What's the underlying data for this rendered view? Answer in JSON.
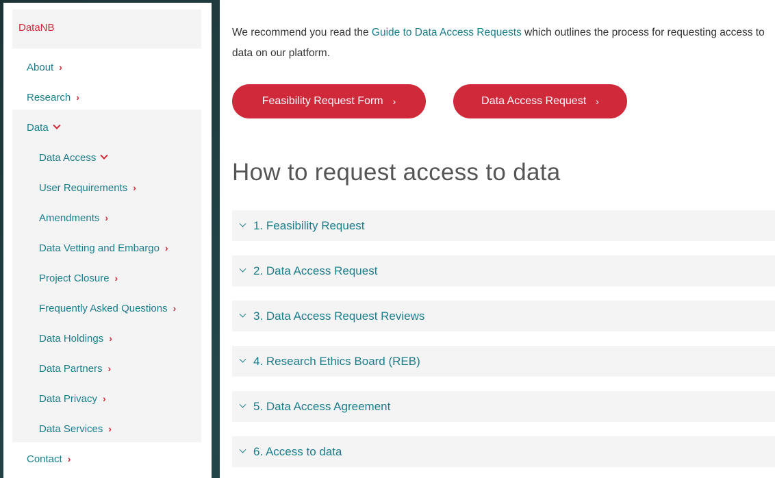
{
  "sidebar": {
    "brand": "DataNB",
    "items": [
      {
        "label": "About"
      },
      {
        "label": "Research"
      },
      {
        "label": "Data"
      },
      {
        "label": "Data Access"
      },
      {
        "label": "User Requirements"
      },
      {
        "label": "Amendments"
      },
      {
        "label": "Data Vetting and Embargo"
      },
      {
        "label": "Project Closure"
      },
      {
        "label": "Frequently Asked Questions"
      },
      {
        "label": "Data Holdings"
      },
      {
        "label": "Data Partners"
      },
      {
        "label": "Data Privacy"
      },
      {
        "label": "Data Services"
      },
      {
        "label": "Contact"
      }
    ]
  },
  "main": {
    "intro_before": "We recommend you read the ",
    "intro_link": "Guide to Data Access Requests",
    "intro_after": " which outlines the process for requesting access to data on our platform.",
    "buttons": {
      "feasibility": "Feasibility Request Form",
      "data_access": "Data Access Request",
      "arrow": "›"
    },
    "section_title": "How to request access to data",
    "accordion": [
      "1. Feasibility Request",
      "2. Data Access Request",
      "3. Data Access Request Reviews",
      "4. Research Ethics Board (REB)",
      "5. Data Access Agreement",
      "6. Access to data"
    ]
  },
  "colors": {
    "accent_red": "#d02a3a",
    "link_teal": "#1b7d8a",
    "panel_gray": "#f4f4f4"
  }
}
